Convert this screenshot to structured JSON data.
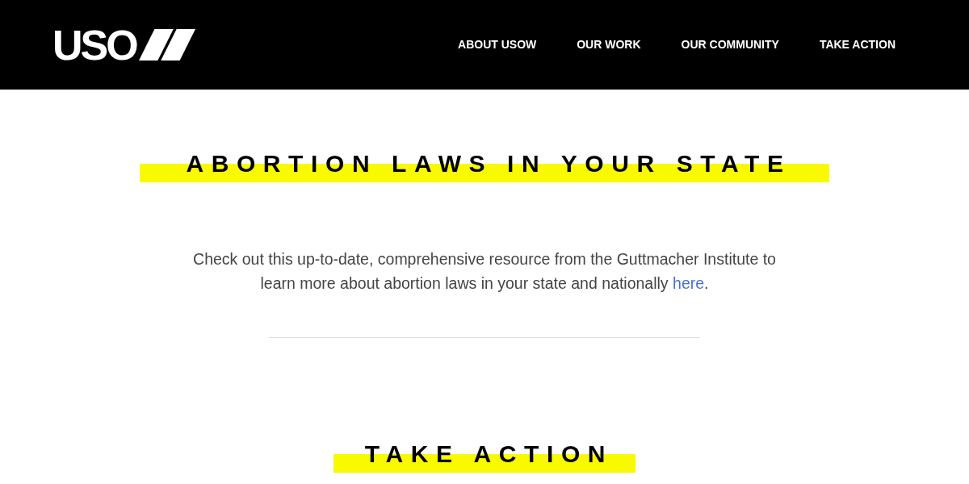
{
  "header": {
    "logo": {
      "text": "USO"
    },
    "nav": [
      {
        "label": "ABOUT USOW"
      },
      {
        "label": "OUR WORK"
      },
      {
        "label": "OUR COMMUNITY"
      },
      {
        "label": "TAKE ACTION"
      }
    ]
  },
  "sections": [
    {
      "heading": "ABORTION LAWS IN YOUR STATE",
      "body": {
        "text": "Check out this up-to-date, comprehensive resource from the Guttmacher Institute to learn more about abortion laws in your state and nationally ",
        "link": "here",
        "after_link": "."
      }
    },
    {
      "heading": "TAKE ACTION"
    }
  ]
}
